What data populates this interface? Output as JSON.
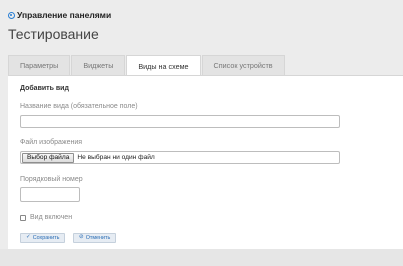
{
  "header": {
    "title": "Управление панелями"
  },
  "page": {
    "title": "Тестирование"
  },
  "tabs": [
    {
      "label": "Параметры"
    },
    {
      "label": "Виджеты"
    },
    {
      "label": "Виды на схеме",
      "active": true
    },
    {
      "label": "Список устройств"
    }
  ],
  "form": {
    "section_title": "Добавить вид",
    "name_label": "Название вида (обязательное поле)",
    "name_value": "",
    "image_label": "Файл изображения",
    "file_button": "Выбор файла",
    "file_status": "Не выбран ни один файл",
    "order_label": "Порядковый номер",
    "order_value": "",
    "enabled_label": "Вид включен",
    "enabled_checked": false
  },
  "actions": {
    "save": {
      "label": "Сохранить",
      "icon": "check-icon"
    },
    "cancel": {
      "label": "Отменить",
      "icon": "cancel-icon"
    }
  },
  "colors": {
    "accent": "#2a7fd4",
    "button_text": "#2a6db5",
    "background": "#ececec"
  }
}
